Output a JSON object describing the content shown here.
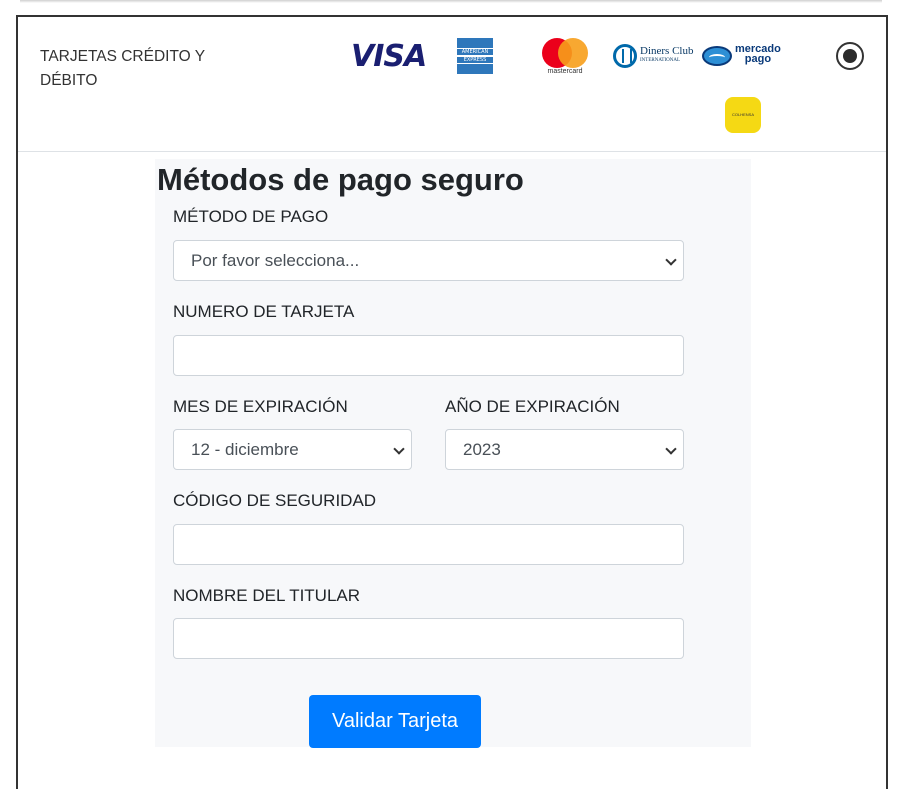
{
  "header": {
    "title": "TARJETAS CRÉDITO Y DÉBITO",
    "logos": {
      "visa": "VISA",
      "amex": [
        "AMERICAN",
        "EXPRESS"
      ],
      "mastercard": "mastercard",
      "diners": "Diners Club",
      "diners_sub": "INTERNATIONAL",
      "mercadopago": [
        "mercado",
        "pago"
      ],
      "efecty": "COLHENSA"
    },
    "radio_selected": true
  },
  "form": {
    "title": "Métodos de pago seguro",
    "payment_method": {
      "label": "MÉTODO DE PAGO",
      "value": "Por favor selecciona..."
    },
    "card_number": {
      "label": "NUMERO DE TARJETA",
      "value": ""
    },
    "exp_month": {
      "label": "MES DE EXPIRACIÓN",
      "value": "12 - diciembre"
    },
    "exp_year": {
      "label": "AÑO DE EXPIRACIÓN",
      "value": "2023"
    },
    "security_code": {
      "label": "CÓDIGO DE SEGURIDAD",
      "value": ""
    },
    "holder_name": {
      "label": "NOMBRE DEL TITULAR",
      "value": ""
    },
    "submit_label": "Validar Tarjeta"
  },
  "colors": {
    "accent": "#007bff",
    "panel_bg": "#f7f8fa",
    "border": "#333333"
  }
}
